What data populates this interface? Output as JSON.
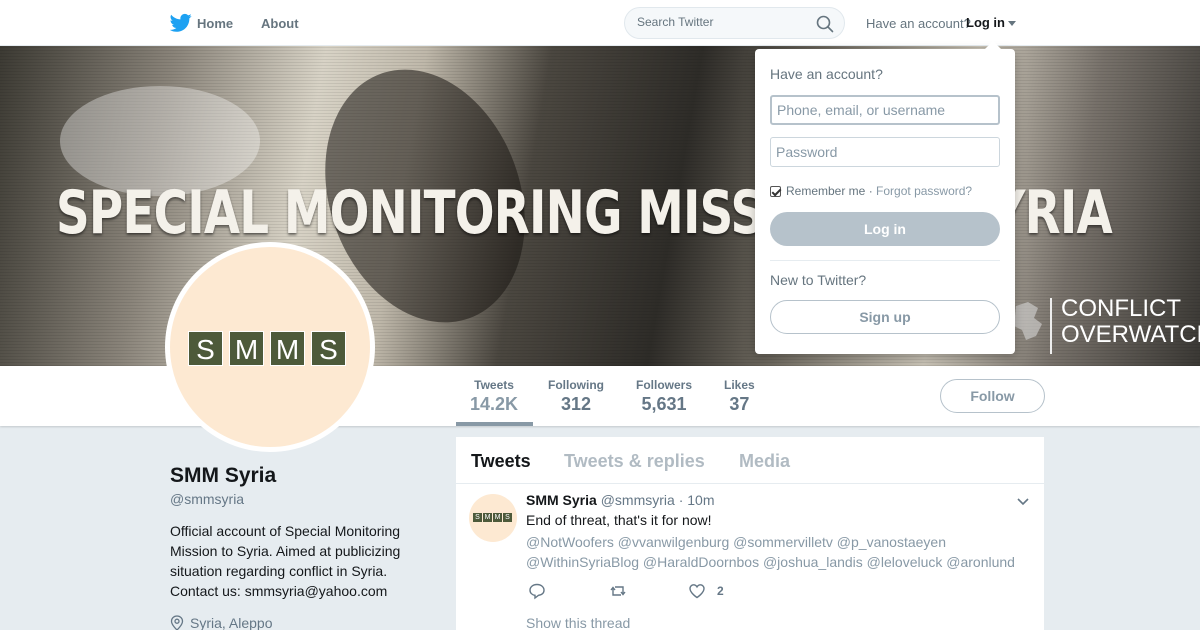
{
  "nav": {
    "home_label": "Home",
    "about_label": "About",
    "search_placeholder": "Search Twitter",
    "have_account": "Have an account?",
    "login_label": "Log in"
  },
  "banner": {
    "title": "SPECIAL MONITORING MISSION TO SYRIA",
    "brand_line1": "CONFLICT",
    "brand_line2": "OVERWATCH"
  },
  "avatar_letters": [
    "S",
    "M",
    "M",
    "S"
  ],
  "stats": [
    {
      "label": "Tweets",
      "value": "14.2K"
    },
    {
      "label": "Following",
      "value": "312"
    },
    {
      "label": "Followers",
      "value": "5,631"
    },
    {
      "label": "Likes",
      "value": "37"
    }
  ],
  "follow_label": "Follow",
  "profile": {
    "name": "SMM Syria",
    "handle": "@smmsyria",
    "bio": "Official account of Special Monitoring Mission to Syria. Aimed at publicizing situation regarding conflict in Syria. Contact us: smmsyria@yahoo.com",
    "location": "Syria, Aleppo"
  },
  "tabs": [
    "Tweets",
    "Tweets & replies",
    "Media"
  ],
  "tweet": {
    "name": "SMM Syria",
    "handle": "@smmsyria",
    "dot": "·",
    "time": "10m",
    "text": "End of threat, that's it for now!",
    "mentions": "@NotWoofers @vvanwilgenburg @sommervilletv @p_vanostaeyen @WithinSyriaBlog @HaraldDoornbos @joshua_landis @leloveluck @aronlund",
    "like_count": "2",
    "show_thread": "Show this thread"
  },
  "login_dropdown": {
    "title": "Have an account?",
    "username_placeholder": "Phone, email, or username",
    "password_placeholder": "Password",
    "remember_me": "Remember me",
    "separator": "·",
    "forgot_password": "Forgot password?",
    "login_button": "Log in",
    "new_to_twitter": "New to Twitter?",
    "signup_button": "Sign up"
  },
  "colors": {
    "twitter_blue": "#1da1f2",
    "muted_gray": "#8899a6",
    "avatar_bg": "#fde9d2",
    "avatar_tile": "#4d5a3a"
  }
}
